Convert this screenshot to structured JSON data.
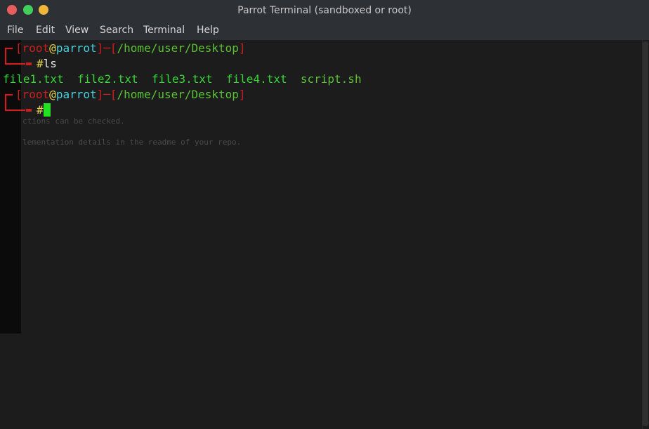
{
  "window": {
    "title": "Parrot Terminal (sandboxed or root)",
    "traffic_colors": {
      "close": "#e85d5d",
      "maximize": "#3fcf5a",
      "minimize": "#f0b63a"
    }
  },
  "menu": {
    "items": [
      "File",
      "Edit",
      "View",
      "Search",
      "Terminal",
      "Help"
    ]
  },
  "terminal": {
    "prompt1": {
      "open": "[",
      "user": "root",
      "at": "@",
      "host": "parrot",
      "close": "]",
      "dash": "─",
      "path_open": "[",
      "path": "/home/user/Desktop",
      "path_close": "]",
      "hash": "#",
      "command": "ls"
    },
    "ls_output": [
      "file1.txt",
      "file2.txt",
      "file3.txt",
      "file4.txt",
      "script.sh"
    ],
    "prompt2": {
      "open": "[",
      "user": "root",
      "at": "@",
      "host": "parrot",
      "close": "]",
      "dash": "─",
      "path_open": "[",
      "path": "/home/user/Desktop",
      "path_close": "]",
      "hash": "#",
      "command": ""
    },
    "ghost_lines": [
      "ctions can be checked.",
      "lementation details in the readme of your repo."
    ]
  },
  "colors": {
    "prompt_bracket": "#cc1f1f",
    "user": "#4ad0e0",
    "at": "#e6d34a",
    "path": "#5bc236",
    "files": "#36d836",
    "cursor": "#22e022"
  }
}
